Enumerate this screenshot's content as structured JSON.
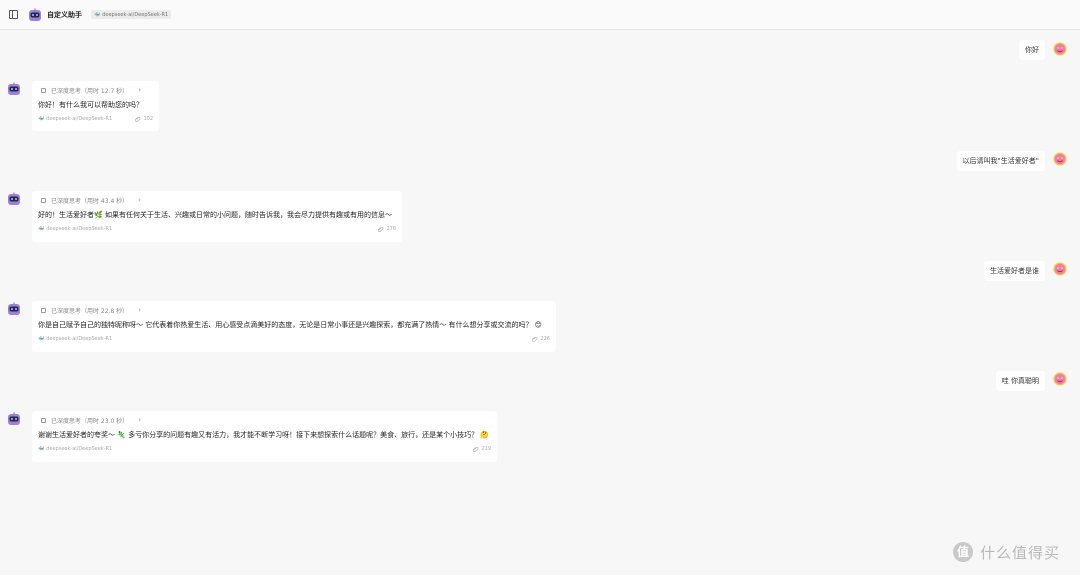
{
  "header": {
    "title": "自定义助手",
    "model": "deepseek-ai/DeepSeek-R1"
  },
  "conversation": [
    {
      "role": "user",
      "text": "你好"
    },
    {
      "role": "assistant",
      "thinking": "已深度思考（用时 12.7 秒）",
      "text": "你好！有什么我可以帮助您的吗？",
      "model": "deepseek-ai/DeepSeek-R1",
      "tokens": "102"
    },
    {
      "role": "user",
      "text": "以后请叫我\"生活爱好者\""
    },
    {
      "role": "assistant",
      "thinking": "已深度思考（用时 43.4 秒）",
      "text": "好的！生活爱好者🌿 如果有任何关于生活、兴趣或日常的小问题，随时告诉我，我会尽力提供有趣或有用的信息～",
      "model": "deepseek-ai/DeepSeek-R1",
      "tokens": "276"
    },
    {
      "role": "user",
      "text": "生活爱好者是谁"
    },
    {
      "role": "assistant",
      "thinking": "已深度思考（用时 22.8 秒）",
      "text": "你是自己赋予自己的独特昵称呀～ 它代表着你热爱生活、用心感受点滴美好的态度，无论是日常小事还是兴趣探索，都充满了热情～ 有什么想分享或交流的吗？ 😊",
      "model": "deepseek-ai/DeepSeek-R1",
      "tokens": "226"
    },
    {
      "role": "user",
      "text": "哇 你真聪明"
    },
    {
      "role": "assistant",
      "thinking": "已深度思考（用时 23.0 秒）",
      "text": "谢谢生活爱好者的夸奖～ 🦎 多亏你分享的问题有趣又有活力，我才能不断学习呀！接下来想探索什么话题呢？美食、旅行，还是某个小技巧？ 🤔",
      "model": "deepseek-ai/DeepSeek-R1",
      "tokens": "219"
    }
  ],
  "watermark": {
    "logo": "值",
    "text": "什么值得买"
  },
  "colors": {
    "background": "#f7f7f7",
    "bubble": "#ffffff",
    "avatar": "#8e6bd6",
    "user_avatar": "#f46aa3"
  }
}
